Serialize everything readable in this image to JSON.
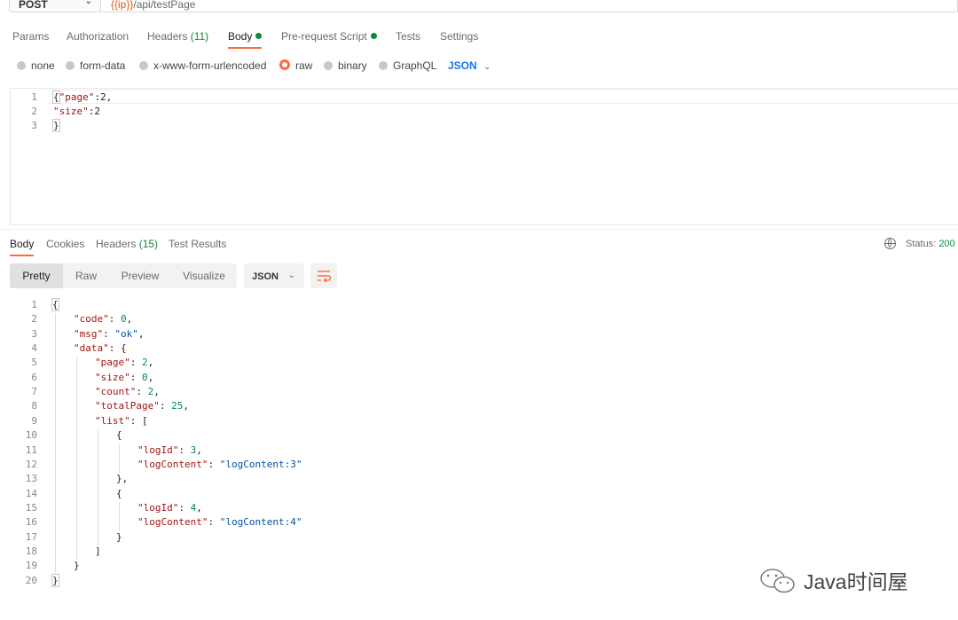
{
  "request": {
    "method": "POST",
    "url_var": "{{ip}}",
    "url_path": "/api/testPage"
  },
  "request_tabs": [
    {
      "label": "Params"
    },
    {
      "label": "Authorization"
    },
    {
      "label": "Headers",
      "count": "(11)"
    },
    {
      "label": "Body",
      "dot": true,
      "active": true
    },
    {
      "label": "Pre-request Script",
      "dot": true
    },
    {
      "label": "Tests"
    },
    {
      "label": "Settings"
    }
  ],
  "body_types": [
    "none",
    "form-data",
    "x-www-form-urlencoded",
    "raw",
    "binary",
    "GraphQL"
  ],
  "body_type_selected": "raw",
  "body_format": "JSON",
  "request_body": {
    "line_numbers": [
      "1",
      "2",
      "3"
    ],
    "line1_brace": "{",
    "line1_key": "\"page\"",
    "line1_rest": ":2,",
    "line2_key": "\"size\"",
    "line2_rest": ":2",
    "line3": "}"
  },
  "response_tabs": [
    {
      "label": "Body",
      "active": true
    },
    {
      "label": "Cookies"
    },
    {
      "label": "Headers",
      "count": "(15)"
    },
    {
      "label": "Test Results"
    }
  ],
  "status": {
    "label": "Status:",
    "value": "200"
  },
  "view_modes": [
    "Pretty",
    "Raw",
    "Preview",
    "Visualize"
  ],
  "view_mode_selected": "Pretty",
  "response_format": "JSON",
  "response_body": [
    {
      "n": "1",
      "indent": 0,
      "parts": [
        [
          "p",
          "{"
        ]
      ]
    },
    {
      "n": "2",
      "indent": 1,
      "parts": [
        [
          "k",
          "\"code\""
        ],
        [
          "p",
          ": "
        ],
        [
          "n",
          "0"
        ],
        [
          "p",
          ","
        ]
      ]
    },
    {
      "n": "3",
      "indent": 1,
      "parts": [
        [
          "k",
          "\"msg\""
        ],
        [
          "p",
          ": "
        ],
        [
          "s",
          "\"ok\""
        ],
        [
          "p",
          ","
        ]
      ]
    },
    {
      "n": "4",
      "indent": 1,
      "parts": [
        [
          "k",
          "\"data\""
        ],
        [
          "p",
          ": {"
        ]
      ]
    },
    {
      "n": "5",
      "indent": 2,
      "parts": [
        [
          "k",
          "\"page\""
        ],
        [
          "p",
          ": "
        ],
        [
          "n",
          "2"
        ],
        [
          "p",
          ","
        ]
      ]
    },
    {
      "n": "6",
      "indent": 2,
      "parts": [
        [
          "k",
          "\"size\""
        ],
        [
          "p",
          ": "
        ],
        [
          "n",
          "0"
        ],
        [
          "p",
          ","
        ]
      ]
    },
    {
      "n": "7",
      "indent": 2,
      "parts": [
        [
          "k",
          "\"count\""
        ],
        [
          "p",
          ": "
        ],
        [
          "n",
          "2"
        ],
        [
          "p",
          ","
        ]
      ]
    },
    {
      "n": "8",
      "indent": 2,
      "parts": [
        [
          "k",
          "\"totalPage\""
        ],
        [
          "p",
          ": "
        ],
        [
          "n",
          "25"
        ],
        [
          "p",
          ","
        ]
      ]
    },
    {
      "n": "9",
      "indent": 2,
      "parts": [
        [
          "k",
          "\"list\""
        ],
        [
          "p",
          ": ["
        ]
      ]
    },
    {
      "n": "10",
      "indent": 3,
      "parts": [
        [
          "p",
          "{"
        ]
      ]
    },
    {
      "n": "11",
      "indent": 4,
      "parts": [
        [
          "k",
          "\"logId\""
        ],
        [
          "p",
          ": "
        ],
        [
          "n",
          "3"
        ],
        [
          "p",
          ","
        ]
      ]
    },
    {
      "n": "12",
      "indent": 4,
      "parts": [
        [
          "k",
          "\"logContent\""
        ],
        [
          "p",
          ": "
        ],
        [
          "s",
          "\"logContent:3\""
        ]
      ]
    },
    {
      "n": "13",
      "indent": 3,
      "parts": [
        [
          "p",
          "},"
        ]
      ]
    },
    {
      "n": "14",
      "indent": 3,
      "parts": [
        [
          "p",
          "{"
        ]
      ]
    },
    {
      "n": "15",
      "indent": 4,
      "parts": [
        [
          "k",
          "\"logId\""
        ],
        [
          "p",
          ": "
        ],
        [
          "n",
          "4"
        ],
        [
          "p",
          ","
        ]
      ]
    },
    {
      "n": "16",
      "indent": 4,
      "parts": [
        [
          "k",
          "\"logContent\""
        ],
        [
          "p",
          ": "
        ],
        [
          "s",
          "\"logContent:4\""
        ]
      ]
    },
    {
      "n": "17",
      "indent": 3,
      "parts": [
        [
          "p",
          "}"
        ]
      ]
    },
    {
      "n": "18",
      "indent": 2,
      "parts": [
        [
          "p",
          "]"
        ]
      ]
    },
    {
      "n": "19",
      "indent": 1,
      "parts": [
        [
          "p",
          "}"
        ]
      ]
    },
    {
      "n": "20",
      "indent": 0,
      "parts": [
        [
          "p",
          "}"
        ]
      ]
    }
  ],
  "watermark": "Java时间屋",
  "colors": {
    "accent": "#ff6c37",
    "success": "#0c8a3e",
    "link": "#1a73e8"
  }
}
